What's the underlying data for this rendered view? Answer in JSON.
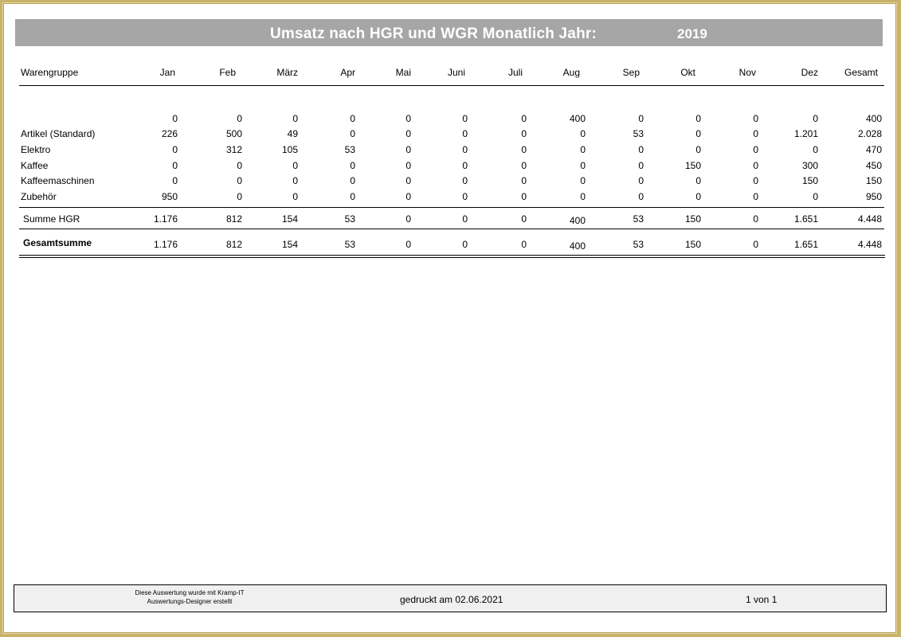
{
  "report": {
    "title": "Umsatz nach HGR und WGR Monatlich Jahr:",
    "year": "2019"
  },
  "columns": [
    "Warengruppe",
    "Jan",
    "Feb",
    "März",
    "Apr",
    "Mai",
    "Juni",
    "Juli",
    "Aug",
    "Sep",
    "Okt",
    "Nov",
    "Dez",
    "Gesamt"
  ],
  "rows": [
    {
      "label": "",
      "values": [
        "0",
        "0",
        "0",
        "0",
        "0",
        "0",
        "0",
        "400",
        "0",
        "0",
        "0",
        "0",
        "400"
      ]
    },
    {
      "label": "Artikel (Standard)",
      "values": [
        "226",
        "500",
        "49",
        "0",
        "0",
        "0",
        "0",
        "0",
        "53",
        "0",
        "0",
        "1.201",
        "2.028"
      ]
    },
    {
      "label": "Elektro",
      "values": [
        "0",
        "312",
        "105",
        "53",
        "0",
        "0",
        "0",
        "0",
        "0",
        "0",
        "0",
        "0",
        "470"
      ]
    },
    {
      "label": "Kaffee",
      "values": [
        "0",
        "0",
        "0",
        "0",
        "0",
        "0",
        "0",
        "0",
        "0",
        "150",
        "0",
        "300",
        "450"
      ]
    },
    {
      "label": "Kaffeemaschinen",
      "values": [
        "0",
        "0",
        "0",
        "0",
        "0",
        "0",
        "0",
        "0",
        "0",
        "0",
        "0",
        "150",
        "150"
      ]
    },
    {
      "label": "Zubehör",
      "values": [
        "950",
        "0",
        "0",
        "0",
        "0",
        "0",
        "0",
        "0",
        "0",
        "0",
        "0",
        "0",
        "950"
      ]
    }
  ],
  "subtotal": {
    "label": "Summe HGR",
    "values": [
      "1.176",
      "812",
      "154",
      "53",
      "0",
      "0",
      "0",
      "400",
      "53",
      "150",
      "0",
      "1.651",
      "4.448"
    ]
  },
  "total": {
    "label": "Gesamtsumme",
    "values": [
      "1.176",
      "812",
      "154",
      "53",
      "0",
      "0",
      "0",
      "400",
      "53",
      "150",
      "0",
      "1.651",
      "4.448"
    ]
  },
  "footer": {
    "note_line1": "Diese Auswertung wurde mit Kramp-IT",
    "note_line2": "Auswertungs-Designer erstellt",
    "printed": "gedruckt am 02.06.2021",
    "page": "1 von 1"
  }
}
